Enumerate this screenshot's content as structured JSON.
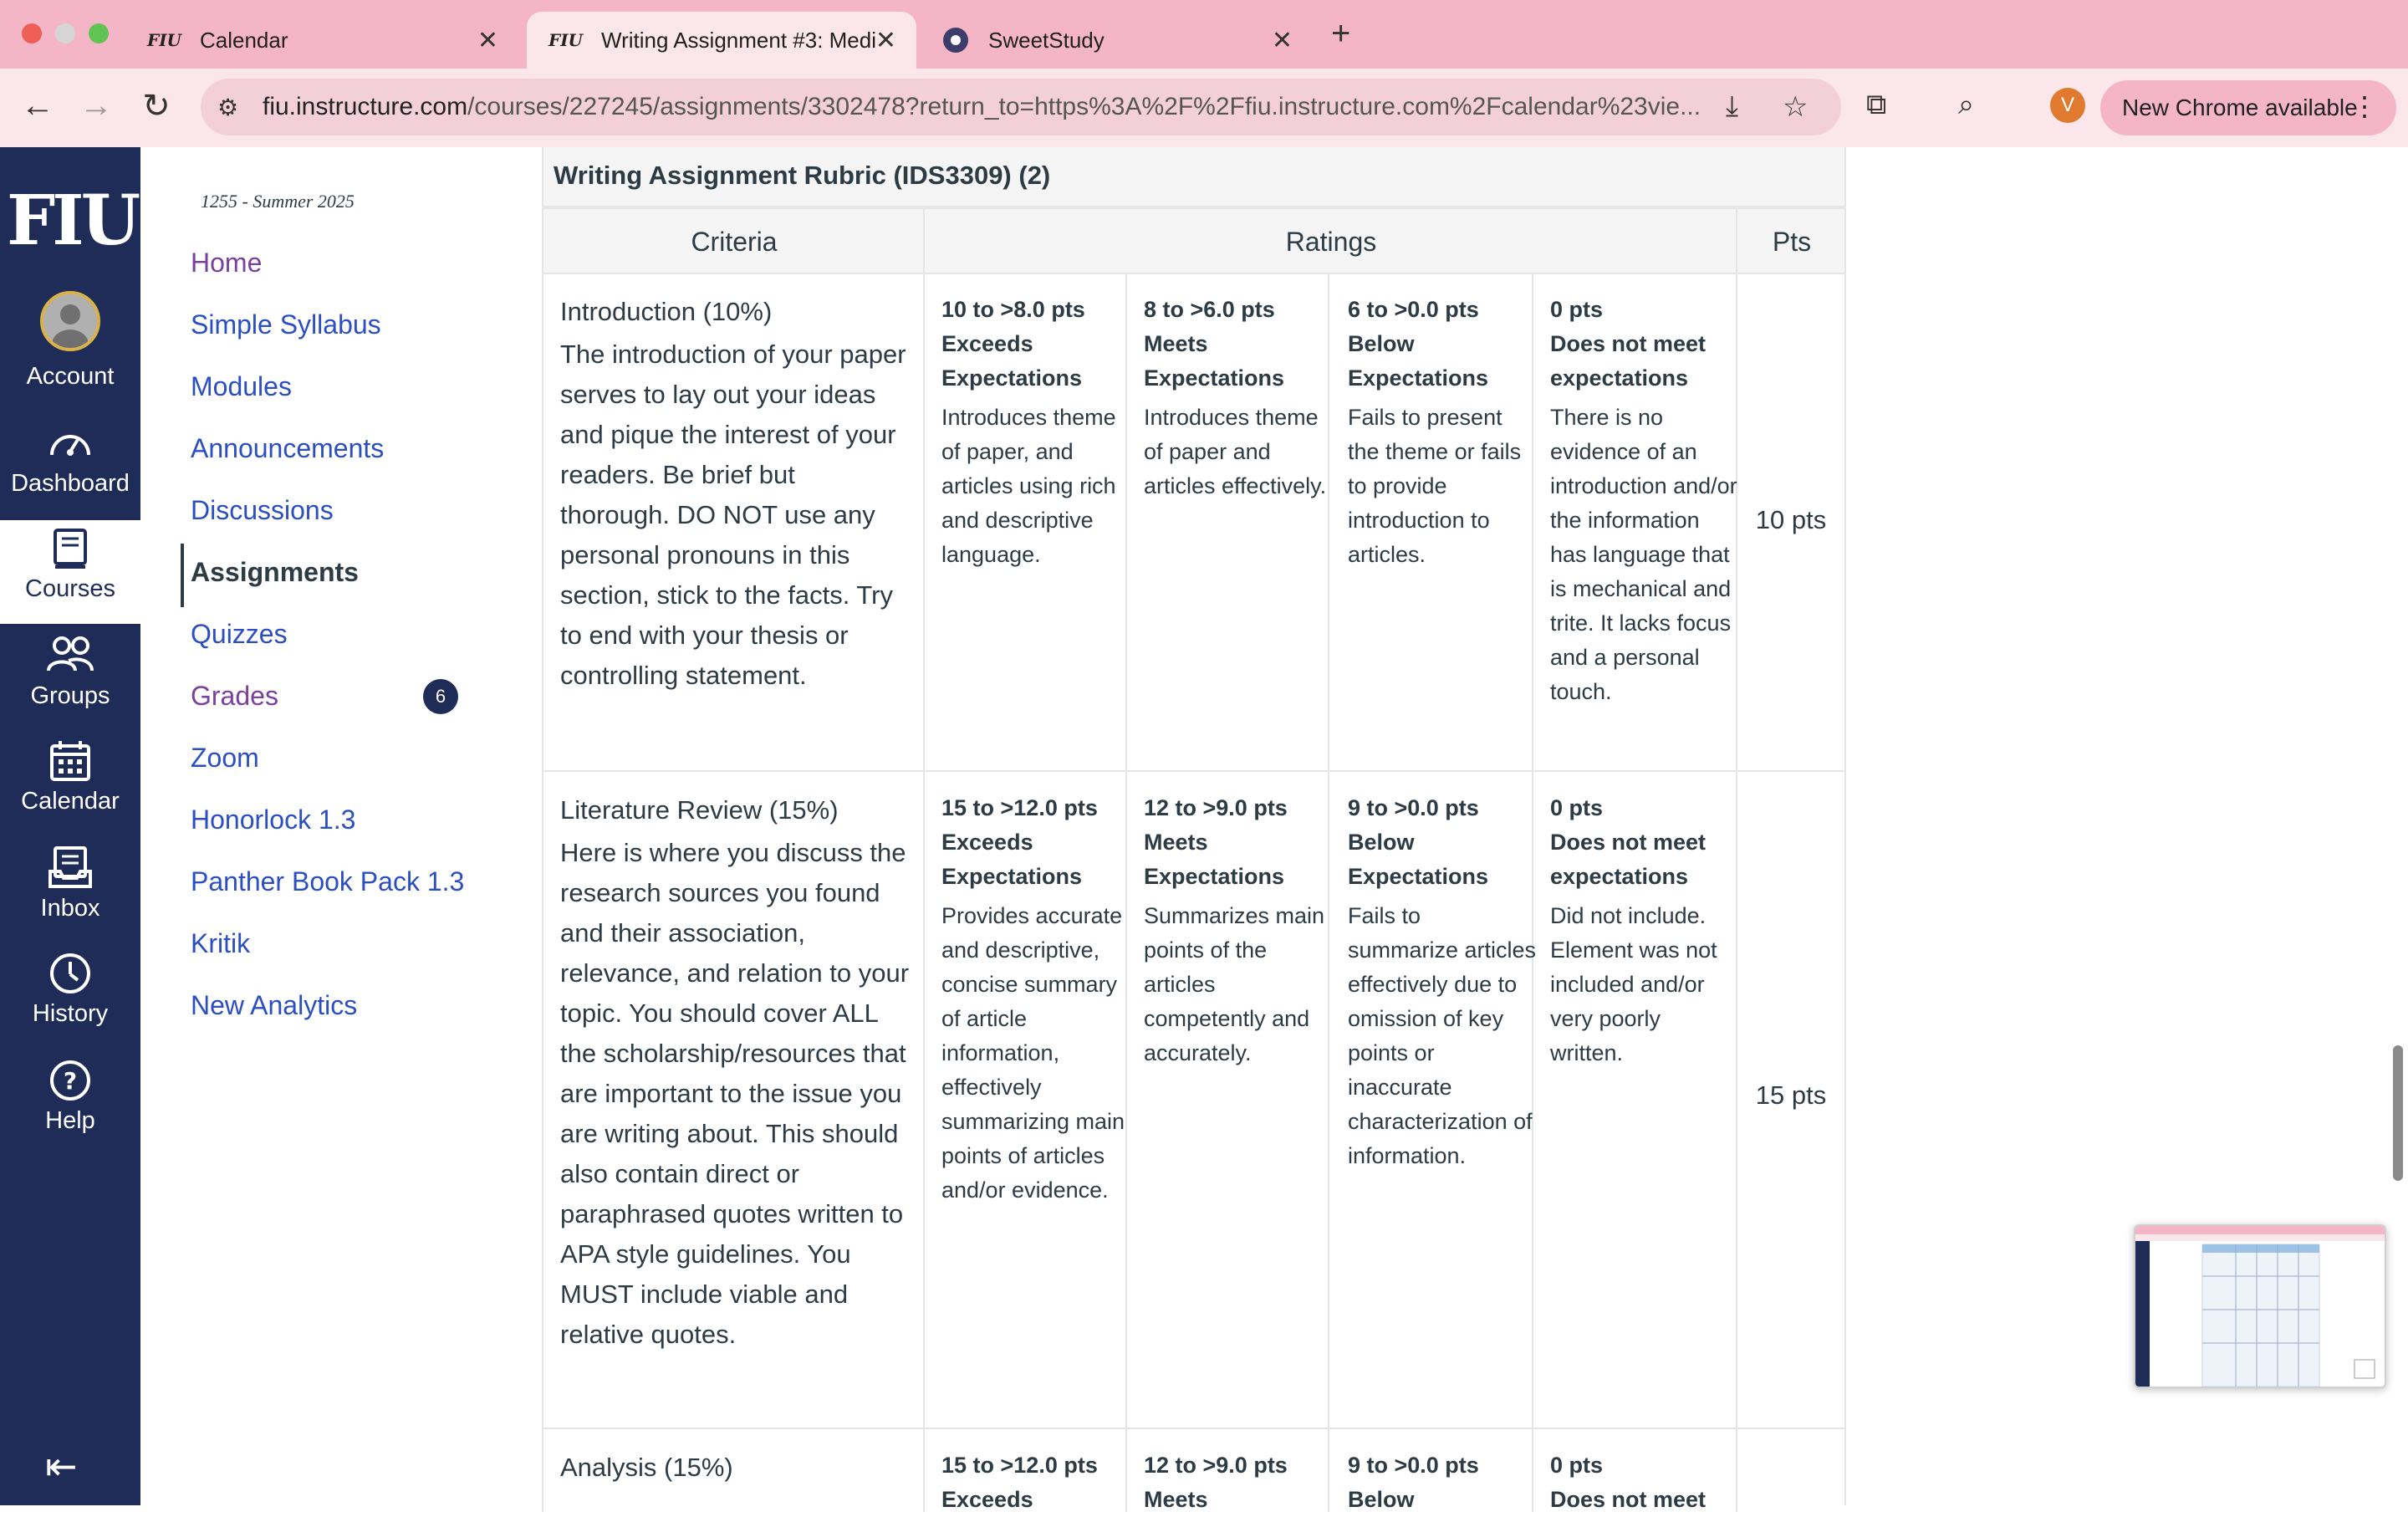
{
  "browser": {
    "tabs": [
      {
        "favicon": "FIU",
        "title": "Calendar"
      },
      {
        "favicon": "FIU",
        "title": "Writing Assignment #3: Medi"
      },
      {
        "favicon": "sweetstudy-icon",
        "title": "SweetStudy"
      }
    ],
    "url_host": "fiu.instructure.com",
    "url_path": "/courses/227245/assignments/3302478?return_to=https%3A%2F%2Ffiu.instructure.com%2Fcalendar%23vie...",
    "profile_initial": "V",
    "update_label": "New Chrome available"
  },
  "global_nav": {
    "logo": "FIU",
    "items": [
      "Account",
      "Dashboard",
      "Courses",
      "Groups",
      "Calendar",
      "Inbox",
      "History",
      "Help"
    ],
    "active": "Courses"
  },
  "course_nav": {
    "term": "1255 - Summer 2025",
    "links": [
      "Home",
      "Simple Syllabus",
      "Modules",
      "Announcements",
      "Discussions",
      "Assignments",
      "Quizzes",
      "Grades",
      "Zoom",
      "Honorlock 1.3",
      "Panther Book Pack 1.3",
      "Kritik",
      "New Analytics"
    ],
    "active": "Assignments",
    "grades_badge": "6"
  },
  "rubric": {
    "title": "Writing Assignment Rubric (IDS3309) (2)",
    "headers": {
      "criteria": "Criteria",
      "ratings": "Ratings",
      "pts": "Pts"
    },
    "rows": [
      {
        "name": "Introduction (10%)",
        "description": "The introduction of your paper serves to lay out your ideas and pique the interest of your readers. Be brief but thorough. DO NOT use any personal pronouns in this section, stick to the facts. Try to end with your thesis or controlling statement.",
        "points": "10 pts",
        "ratings": [
          {
            "pts": "10 to >8.0 pts",
            "label": "Exceeds Expectations",
            "desc": "Introduces theme of paper, and articles using rich and descriptive language."
          },
          {
            "pts": "8 to >6.0 pts",
            "label": "Meets Expectations",
            "desc": "Introduces theme of paper and articles effectively."
          },
          {
            "pts": "6 to >0.0 pts",
            "label": "Below Expectations",
            "desc": "Fails to present the theme or fails to provide introduction to articles."
          },
          {
            "pts": "0 pts",
            "label": "Does not meet expectations",
            "desc": "There is no evidence of an introduction and/or the information has language that is mechanical and trite. It lacks focus and a personal touch."
          }
        ]
      },
      {
        "name": "Literature Review (15%)",
        "description": "Here is where you discuss the research sources you found and their association, relevance, and relation to your topic. You should cover ALL the scholarship/resources that are important to the issue you are writing about. This should also contain direct or paraphrased quotes written to APA style guidelines. You MUST include viable and relative quotes.",
        "points": "15 pts",
        "ratings": [
          {
            "pts": "15 to >12.0 pts",
            "label": "Exceeds Expectations",
            "desc": "Provides accurate and descriptive, concise summary of article information, effectively summarizing main points of articles and/or evidence."
          },
          {
            "pts": "12 to >9.0 pts",
            "label": "Meets Expectations",
            "desc": "Summarizes main points of the articles competently and accurately."
          },
          {
            "pts": "9 to >0.0 pts",
            "label": "Below Expectations",
            "desc": "Fails to summarize articles effectively due to omission of key points or inaccurate characterization of information."
          },
          {
            "pts": "0 pts",
            "label": "Does not meet expectations",
            "desc": "Did not include. Element was not included and/or very poorly written."
          }
        ]
      },
      {
        "name": "Analysis (15%)",
        "description": "",
        "points": "",
        "ratings": [
          {
            "pts": "15 to >12.0 pts",
            "label": "Exceeds",
            "desc": ""
          },
          {
            "pts": "12 to >9.0 pts",
            "label": "Meets",
            "desc": ""
          },
          {
            "pts": "9 to >0.0 pts",
            "label": "Below",
            "desc": ""
          },
          {
            "pts": "0 pts",
            "label": "Does not meet",
            "desc": ""
          }
        ]
      }
    ]
  }
}
